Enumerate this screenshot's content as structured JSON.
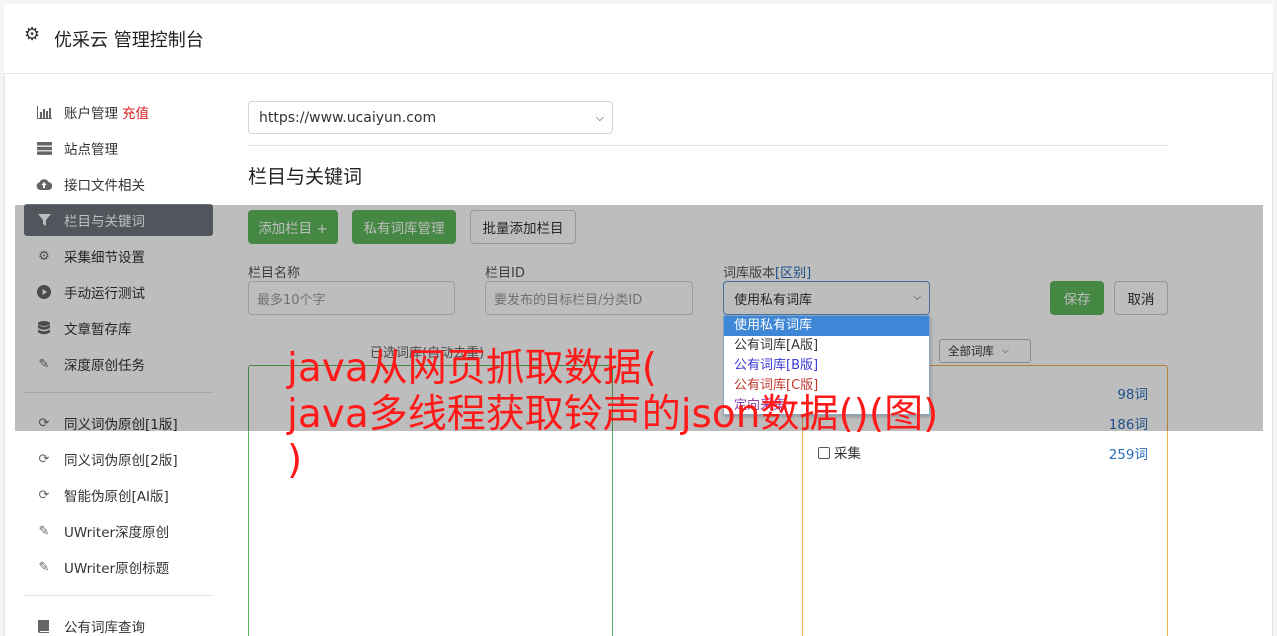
{
  "header": {
    "gear_icon": "gear-icon",
    "title": "优采云 管理控制台"
  },
  "sidebar": {
    "items": [
      {
        "label": "账户管理",
        "badge": "充值",
        "icon": "bar-chart-icon"
      },
      {
        "label": "站点管理",
        "icon": "server-icon"
      },
      {
        "label": "接口文件相关",
        "icon": "cloud-upload-icon"
      },
      {
        "label": "栏目与关键词",
        "icon": "filter-icon",
        "active": true
      },
      {
        "label": "采集细节设置",
        "icon": "cogs-icon"
      },
      {
        "label": "手动运行测试",
        "icon": "play-circle-icon"
      },
      {
        "label": "文章暂存库",
        "icon": "database-icon"
      },
      {
        "label": "深度原创任务",
        "icon": "edit-icon"
      }
    ],
    "items2": [
      {
        "label": "同义词伪原创[1版]",
        "icon": "refresh-icon"
      },
      {
        "label": "同义词伪原创[2版]",
        "icon": "refresh-icon"
      },
      {
        "label": "智能伪原创[AI版]",
        "icon": "refresh-icon"
      },
      {
        "label": "UWriter深度原创",
        "icon": "edit-icon"
      },
      {
        "label": "UWriter原创标题",
        "icon": "edit-icon"
      }
    ],
    "items3": [
      {
        "label": "公有词库查询",
        "icon": "book-icon"
      }
    ]
  },
  "main": {
    "site_select": "https://www.ucaiyun.com",
    "section_title": "栏目与关键词",
    "buttons": {
      "add_column": "添加栏目 +",
      "private_lib": "私有词库管理",
      "batch_add": "批量添加栏目",
      "save": "保存",
      "cancel": "取消"
    },
    "form": {
      "name_label": "栏目名称",
      "name_placeholder": "最多10个字",
      "id_label": "栏目ID",
      "id_placeholder": "要发布的目标栏目/分类ID",
      "version_label": "词库版本",
      "version_link": "[区别]",
      "version_value": "使用私有词库"
    },
    "version_options": [
      "使用私有词库",
      "公有词库[A版]",
      "公有词库[B版]",
      "公有词库[C版]",
      "定向采集"
    ],
    "selected_libs_title": "已选词库(自动去重)",
    "all_libs_filter": "全部词库",
    "lib_rows": [
      {
        "label": "",
        "count": "98词"
      },
      {
        "label": "",
        "count": "186词"
      },
      {
        "label": "采集",
        "count": "259词"
      }
    ]
  },
  "watermark": {
    "line1": "java从网页抓取数据(",
    "line2": "java多线程获取铃声的json数据()(图)",
    "line3": ")"
  },
  "colors": {
    "accent_green": "#5cb85c",
    "active_nav": "#6c757d",
    "link_blue": "#2a6ebb",
    "watermark_red": "#ff1a1a"
  }
}
